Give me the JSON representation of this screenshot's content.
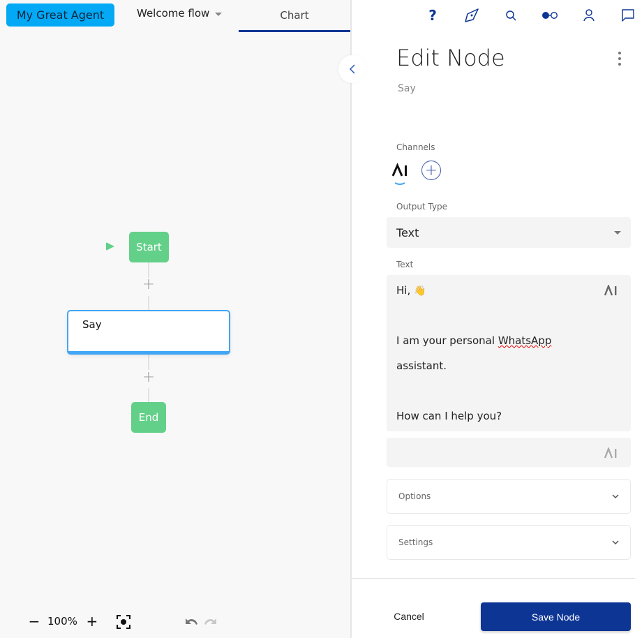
{
  "header": {
    "agent_name": "My Great Agent",
    "flow_name": "Welcome flow",
    "active_tab": "Chart"
  },
  "canvas": {
    "nodes": [
      {
        "type": "start",
        "label": "Start"
      },
      {
        "type": "say",
        "label": "Say"
      },
      {
        "type": "end",
        "label": "End"
      }
    ],
    "add_symbol": "+",
    "zoom": {
      "minus": "−",
      "value": "100%",
      "plus": "+"
    }
  },
  "top_icons": [
    "help-icon",
    "compass-icon",
    "search-icon",
    "toggle-icon",
    "user-icon",
    "chat-icon"
  ],
  "panel": {
    "title": "Edit Node",
    "subtitle": "Say",
    "channels_label": "Channels",
    "channel_active": "AI",
    "output_type_label": "Output Type",
    "output_type_value": "Text",
    "text_label": "Text",
    "text_lines": [
      "Hi, ",
      "",
      "I am your personal ",
      "assistant.",
      "",
      "How can I help you?"
    ],
    "misspelled_word": "WhatsApp",
    "wave_emoji": "👋",
    "options_label": "Options",
    "settings_label": "Settings",
    "cancel_label": "Cancel",
    "save_label": "Save Node"
  },
  "colors": {
    "agent_button": "#03a9f4",
    "primary": "#0d3594",
    "node_green": "#63d089",
    "selected_node_border": "#42a5f5"
  }
}
